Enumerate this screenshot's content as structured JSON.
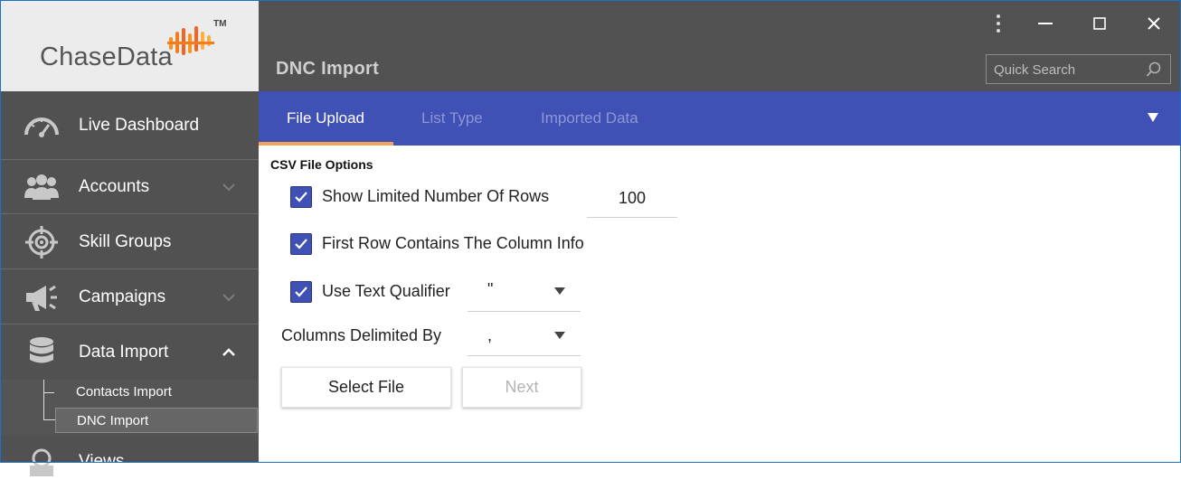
{
  "app": {
    "logo_text": "ChaseData",
    "logo_tm": "TM"
  },
  "header": {
    "title": "DNC Import",
    "search_placeholder": "Quick Search"
  },
  "sidebar": {
    "items": [
      {
        "label": "Live Dashboard",
        "icon": "gauge-icon"
      },
      {
        "label": "Accounts",
        "icon": "users-icon",
        "chevron": "down"
      },
      {
        "label": "Skill Groups",
        "icon": "crosshair-icon"
      },
      {
        "label": "Campaigns",
        "icon": "megaphone-icon",
        "chevron": "down"
      },
      {
        "label": "Data Import",
        "icon": "database-icon",
        "chevron": "up"
      },
      {
        "label": "Views",
        "icon": "views-icon"
      }
    ],
    "sub_items": [
      {
        "label": "Contacts Import",
        "active": false
      },
      {
        "label": "DNC Import",
        "active": true
      }
    ]
  },
  "tabs": [
    {
      "label": "File Upload",
      "active": true
    },
    {
      "label": "List Type",
      "active": false
    },
    {
      "label": "Imported Data",
      "active": false
    }
  ],
  "csv_options": {
    "section_title": "CSV File Options",
    "show_limited_rows": {
      "label": "Show Limited Number Of Rows",
      "checked": true,
      "value": "100"
    },
    "first_row_header": {
      "label": "First Row Contains The Column Info",
      "checked": true
    },
    "text_qualifier": {
      "label": "Use Text Qualifier",
      "checked": true,
      "value": "\""
    },
    "delimiter": {
      "label": "Columns Delimited By",
      "value": ","
    }
  },
  "buttons": {
    "select_file": "Select File",
    "next": "Next"
  },
  "colors": {
    "accent": "#3f51b5",
    "tab_underline": "#f3a35f",
    "sidebar_bg": "#515151",
    "header_bg": "#525252"
  }
}
